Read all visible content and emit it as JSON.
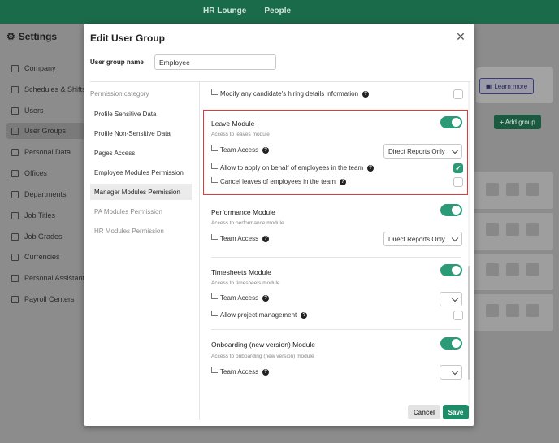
{
  "topnav": [
    "HR Lounge",
    "People"
  ],
  "settings_title": "Settings",
  "sidebar": [
    {
      "label": "Company",
      "icon": "building-icon"
    },
    {
      "label": "Schedules & Shifts",
      "icon": "calendar-icon"
    },
    {
      "label": "Users",
      "icon": "users-icon"
    },
    {
      "label": "User Groups",
      "icon": "user-group-icon",
      "active": true
    },
    {
      "label": "Personal Data",
      "icon": "id-card-icon"
    },
    {
      "label": "Offices",
      "icon": "office-icon"
    },
    {
      "label": "Departments",
      "icon": "department-icon"
    },
    {
      "label": "Job Titles",
      "icon": "briefcase-icon"
    },
    {
      "label": "Job Grades",
      "icon": "grade-icon"
    },
    {
      "label": "Currencies",
      "icon": "currency-icon"
    },
    {
      "label": "Personal Assistant",
      "icon": "assistant-icon"
    },
    {
      "label": "Payroll Centers",
      "icon": "payroll-icon"
    }
  ],
  "learn_more": "Learn more",
  "add_group": "+ Add group",
  "modal": {
    "title": "Edit User Group",
    "name_label": "User group name",
    "name_value": "Employee",
    "category_header": "Permission category",
    "categories": [
      {
        "label": "Profile Sensitive Data"
      },
      {
        "label": "Profile Non-Sensitive Data"
      },
      {
        "label": "Pages Access"
      },
      {
        "label": "Employee Modules Permission"
      },
      {
        "label": "Manager Modules Permission",
        "active": true
      },
      {
        "label": "PA Modules Permission",
        "muted": true
      },
      {
        "label": "HR Modules Permission",
        "muted": true
      }
    ],
    "prev_row": "Modify any candidate's hiring details information",
    "leave": {
      "title": "Leave Module",
      "subtitle": "Access to leaves module",
      "team_access": "Team Access",
      "team_access_value": "Direct Reports Only",
      "apply": "Allow to apply on behalf of employees in the team",
      "cancel": "Cancel leaves of employees in the team"
    },
    "performance": {
      "title": "Performance Module",
      "subtitle": "Access to performance module",
      "team_access": "Team Access",
      "team_access_value": "Direct Reports Only"
    },
    "timesheets": {
      "title": "Timesheets Module",
      "subtitle": "Access to timesheets module",
      "team_access": "Team Access",
      "project_mgmt": "Allow project management"
    },
    "onboarding": {
      "title": "Onboarding (new version) Module",
      "subtitle": "Access to onboarding (new version) module",
      "team_access": "Team Access"
    },
    "cancel_label": "Cancel",
    "save_label": "Save"
  },
  "colors": {
    "accent": "#2a9a77",
    "highlight": "#e03b3b",
    "header": "#1a6b4a"
  }
}
